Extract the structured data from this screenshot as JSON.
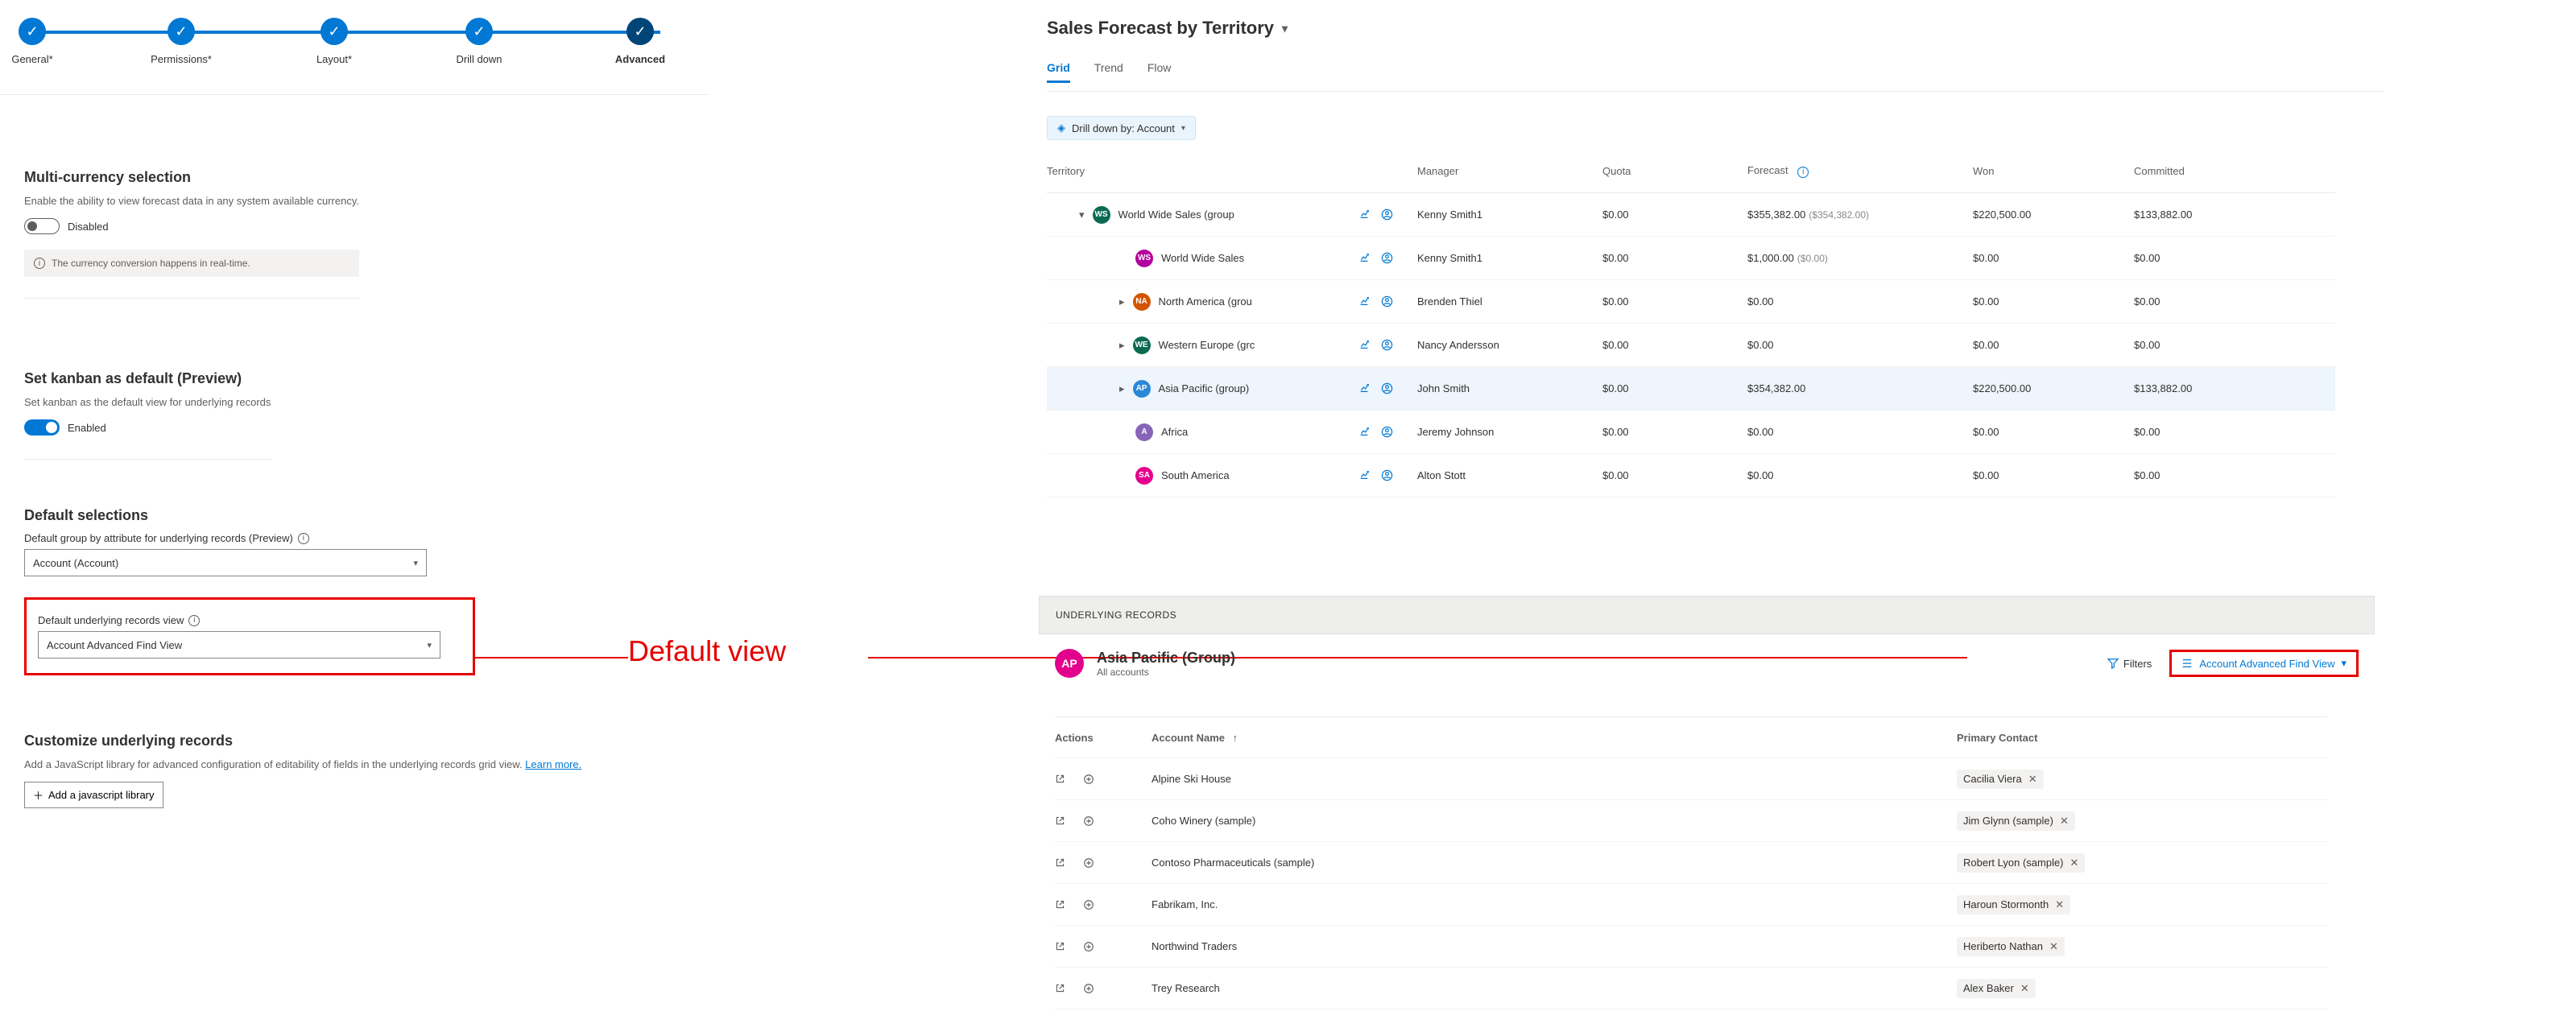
{
  "stepper": {
    "steps": [
      {
        "label": "General*"
      },
      {
        "label": "Permissions*"
      },
      {
        "label": "Layout*"
      },
      {
        "label": "Drill down"
      },
      {
        "label": "Advanced"
      }
    ]
  },
  "multi_currency": {
    "title": "Multi-currency selection",
    "desc": "Enable the ability to view forecast data in any system available currency.",
    "state": "Disabled",
    "note": "The currency conversion happens in real-time."
  },
  "kanban": {
    "title": "Set kanban as default (Preview)",
    "desc": "Set kanban as the default view for underlying records",
    "state": "Enabled"
  },
  "default_selections": {
    "title": "Default selections",
    "group_label": "Default group by attribute for underlying records (Preview)",
    "group_value": "Account (Account)",
    "view_label": "Default underlying records view",
    "view_value": "Account Advanced Find View"
  },
  "customize": {
    "title": "Customize underlying records",
    "desc_a": "Add a JavaScript library for advanced configuration of editability of fields in the underlying records grid view. ",
    "desc_link": "Learn more.",
    "button": "Add a javascript library"
  },
  "callout": {
    "label": "Default view"
  },
  "forecast": {
    "title": "Sales Forecast by Territory",
    "tabs": {
      "t0": "Grid",
      "t1": "Trend",
      "t2": "Flow"
    },
    "drill": {
      "label": "Drill down by: Account"
    },
    "columns": {
      "c0": "Territory",
      "c1": "Manager",
      "c2": "Quota",
      "c3": "Forecast",
      "c4": "Won",
      "c5": "Committed"
    },
    "rows": [
      {
        "indent": 0,
        "expander": "open",
        "avatar": "WS",
        "color": "#0b6a53",
        "name": "World Wide Sales (group",
        "manager": "Kenny Smith1",
        "quota": "$0.00",
        "forecast": "$355,382.00",
        "forecast_sub": "($354,382.00)",
        "won": "$220,500.00",
        "committed": "$133,882.00",
        "highlight": false
      },
      {
        "indent": 1,
        "expander": "",
        "avatar": "WS",
        "color": "#b4009e",
        "name": "World Wide Sales",
        "manager": "Kenny Smith1",
        "quota": "$0.00",
        "forecast": "$1,000.00",
        "forecast_sub": "($0.00)",
        "won": "$0.00",
        "committed": "$0.00",
        "highlight": false
      },
      {
        "indent": 1,
        "expander": "closed",
        "avatar": "NA",
        "color": "#d35400",
        "name": "North America (grou",
        "manager": "Brenden Thiel",
        "quota": "$0.00",
        "forecast": "$0.00",
        "forecast_sub": "",
        "won": "$0.00",
        "committed": "$0.00",
        "highlight": false
      },
      {
        "indent": 1,
        "expander": "closed",
        "avatar": "WE",
        "color": "#0b6a53",
        "name": "Western Europe (grc",
        "manager": "Nancy Andersson",
        "quota": "$0.00",
        "forecast": "$0.00",
        "forecast_sub": "",
        "won": "$0.00",
        "committed": "$0.00",
        "highlight": false
      },
      {
        "indent": 1,
        "expander": "closed",
        "avatar": "AP",
        "color": "#2b88d8",
        "name": "Asia Pacific (group)",
        "manager": "John Smith",
        "quota": "$0.00",
        "forecast": "$354,382.00",
        "forecast_sub": "",
        "won": "$220,500.00",
        "committed": "$133,882.00",
        "highlight": true
      },
      {
        "indent": 1,
        "expander": "",
        "avatar": "A",
        "color": "#8764b8",
        "name": "Africa",
        "manager": "Jeremy Johnson",
        "quota": "$0.00",
        "forecast": "$0.00",
        "forecast_sub": "",
        "won": "$0.00",
        "committed": "$0.00",
        "highlight": false
      },
      {
        "indent": 1,
        "expander": "",
        "avatar": "SA",
        "color": "#e3008c",
        "name": "South America",
        "manager": "Alton Stott",
        "quota": "$0.00",
        "forecast": "$0.00",
        "forecast_sub": "",
        "won": "$0.00",
        "committed": "$0.00",
        "highlight": false
      }
    ]
  },
  "underlying": {
    "bar": "UNDERLYING RECORDS",
    "avatar": "AP",
    "title": "Asia Pacific (Group)",
    "sub": "All accounts",
    "filters": "Filters",
    "view": "Account Advanced Find View",
    "columns": {
      "c0": "Actions",
      "c1": "Account Name",
      "sort": "↑",
      "c2": "Primary Contact"
    },
    "rows": [
      {
        "name": "Alpine Ski House",
        "contact": "Cacilia Viera"
      },
      {
        "name": "Coho Winery (sample)",
        "contact": "Jim Glynn (sample)"
      },
      {
        "name": "Contoso Pharmaceuticals (sample)",
        "contact": "Robert Lyon (sample)"
      },
      {
        "name": "Fabrikam, Inc.",
        "contact": "Haroun Stormonth"
      },
      {
        "name": "Northwind Traders",
        "contact": "Heriberto Nathan"
      },
      {
        "name": "Trey Research",
        "contact": "Alex Baker"
      }
    ]
  }
}
